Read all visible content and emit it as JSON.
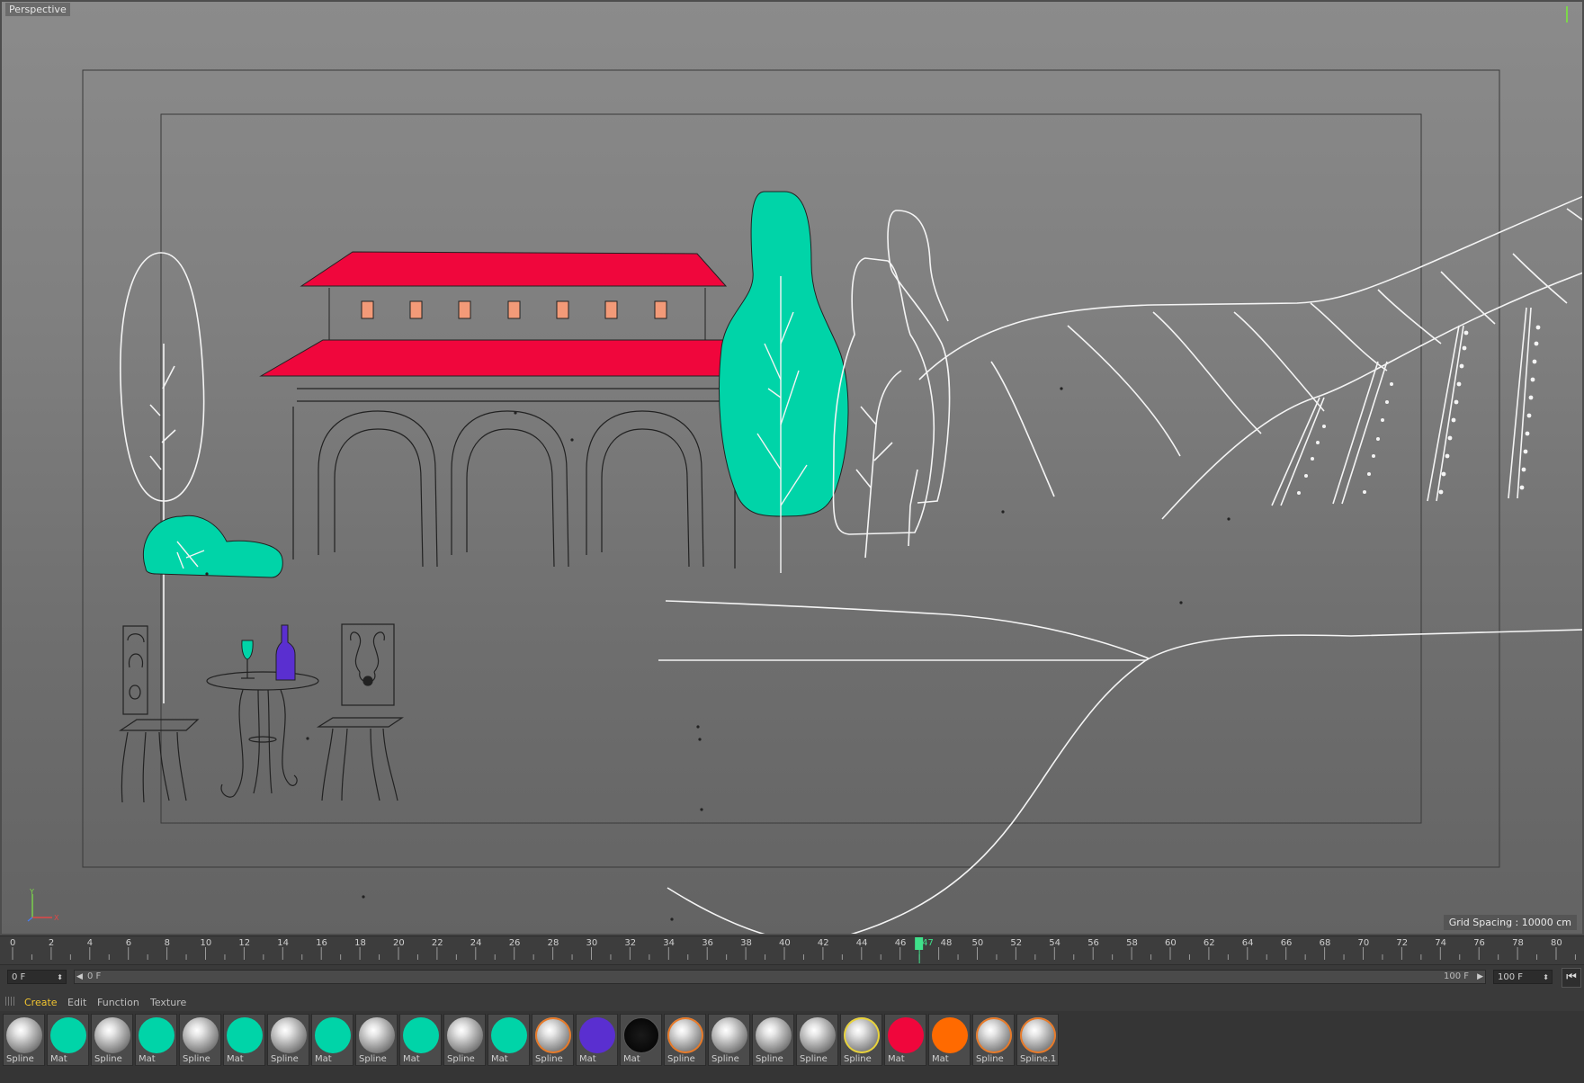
{
  "viewport": {
    "label": "Perspective",
    "grid_spacing": "Grid Spacing : 10000 cm",
    "axis_labels": {
      "y": "Y",
      "x": "X"
    }
  },
  "timeline": {
    "ticks": [
      "0",
      "2",
      "4",
      "6",
      "8",
      "10",
      "12",
      "14",
      "16",
      "18",
      "20",
      "22",
      "24",
      "26",
      "28",
      "30",
      "32",
      "34",
      "36",
      "38",
      "40",
      "42",
      "44",
      "46",
      "47",
      "48",
      "50",
      "52",
      "54",
      "56",
      "58",
      "60",
      "62",
      "64",
      "66",
      "68",
      "70",
      "72",
      "74",
      "76",
      "78",
      "80"
    ],
    "current_frame": "47",
    "accent": "#3fe08a"
  },
  "controls": {
    "current_field": "0 F",
    "range_start": "0 F",
    "range_end": "100 F",
    "end_field": "100 F"
  },
  "menu": {
    "items": [
      {
        "label": "Create",
        "active": true
      },
      {
        "label": "Edit",
        "active": false
      },
      {
        "label": "Function",
        "active": false
      },
      {
        "label": "Texture",
        "active": false
      }
    ]
  },
  "materials": [
    {
      "label": "Spline",
      "type": "grey"
    },
    {
      "label": "Mat",
      "color": "#00d4a8"
    },
    {
      "label": "Spline",
      "type": "grey"
    },
    {
      "label": "Mat",
      "color": "#00d4a8"
    },
    {
      "label": "Spline",
      "type": "grey"
    },
    {
      "label": "Mat",
      "color": "#00d4a8"
    },
    {
      "label": "Spline",
      "type": "grey"
    },
    {
      "label": "Mat",
      "color": "#00d4a8"
    },
    {
      "label": "Spline",
      "type": "grey"
    },
    {
      "label": "Mat",
      "color": "#00d4a8"
    },
    {
      "label": "Spline",
      "type": "grey"
    },
    {
      "label": "Mat",
      "color": "#00d4a8"
    },
    {
      "label": "Spline",
      "type": "grey",
      "ring": "#e87a28"
    },
    {
      "label": "Mat",
      "color": "#5a2fd0"
    },
    {
      "label": "Mat",
      "type": "black"
    },
    {
      "label": "Spline",
      "type": "grey",
      "ring": "#e87a28"
    },
    {
      "label": "Spline",
      "type": "grey"
    },
    {
      "label": "Spline",
      "type": "grey"
    },
    {
      "label": "Spline",
      "type": "grey"
    },
    {
      "label": "Spline",
      "type": "grey",
      "ring": "#e8d23a"
    },
    {
      "label": "Mat",
      "color": "#f0063c"
    },
    {
      "label": "Mat",
      "color": "#ff6a00"
    },
    {
      "label": "Spline",
      "type": "grey",
      "ring": "#e87a28"
    },
    {
      "label": "Spline.1",
      "type": "grey",
      "ring": "#e87a28"
    }
  ],
  "scene_colors": {
    "teal": "#00d4a8",
    "roof": "#f0063c",
    "window": "#f39a78",
    "bottle": "#5a2fd0",
    "lines": "#f4f4f4"
  }
}
